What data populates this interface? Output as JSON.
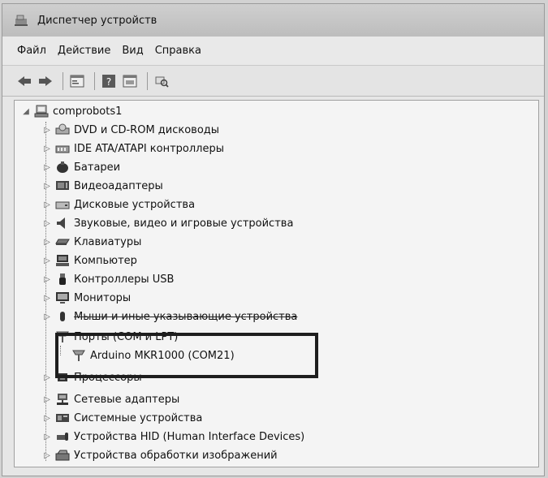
{
  "window": {
    "title": "Диспетчер устройств"
  },
  "menu": {
    "items": [
      "Файл",
      "Действие",
      "Вид",
      "Справка"
    ]
  },
  "toolbar": {
    "buttons": [
      "back-icon",
      "forward-icon",
      "properties-icon",
      "help-icon",
      "view-icon",
      "scan-hardware-icon"
    ]
  },
  "tree": {
    "root": {
      "label": "comprobots1",
      "icon": "computer-icon"
    },
    "items": [
      {
        "label": "DVD и CD-ROM дисководы",
        "icon": "dvd-drive-icon"
      },
      {
        "label": "IDE ATA/ATAPI контроллеры",
        "icon": "ide-controller-icon"
      },
      {
        "label": "Батареи",
        "icon": "battery-icon"
      },
      {
        "label": "Видеоадаптеры",
        "icon": "display-adapter-icon"
      },
      {
        "label": "Дисковые устройства",
        "icon": "disk-drive-icon"
      },
      {
        "label": "Звуковые, видео и игровые устройства",
        "icon": "speaker-icon"
      },
      {
        "label": "Клавиатуры",
        "icon": "keyboard-icon"
      },
      {
        "label": "Компьютер",
        "icon": "computer-icon"
      },
      {
        "label": "Контроллеры USB",
        "icon": "usb-icon"
      },
      {
        "label": "Мониторы",
        "icon": "monitor-icon"
      },
      {
        "label": "Мыши и иные указывающие устройства",
        "icon": "mouse-icon"
      },
      {
        "label": "Порты (COM и LPT)",
        "icon": "port-icon",
        "expanded": true,
        "child": {
          "label": "Arduino MKR1000 (COM21)",
          "icon": "port-icon"
        }
      },
      {
        "label": "Процессоры",
        "icon": "processor-icon"
      },
      {
        "label": "Сетевые адаптеры",
        "icon": "network-adapter-icon"
      },
      {
        "label": "Системные устройства",
        "icon": "system-device-icon"
      },
      {
        "label": "Устройства HID (Human Interface Devices)",
        "icon": "hid-icon"
      },
      {
        "label": "Устройства обработки изображений",
        "icon": "imaging-device-icon"
      }
    ]
  }
}
